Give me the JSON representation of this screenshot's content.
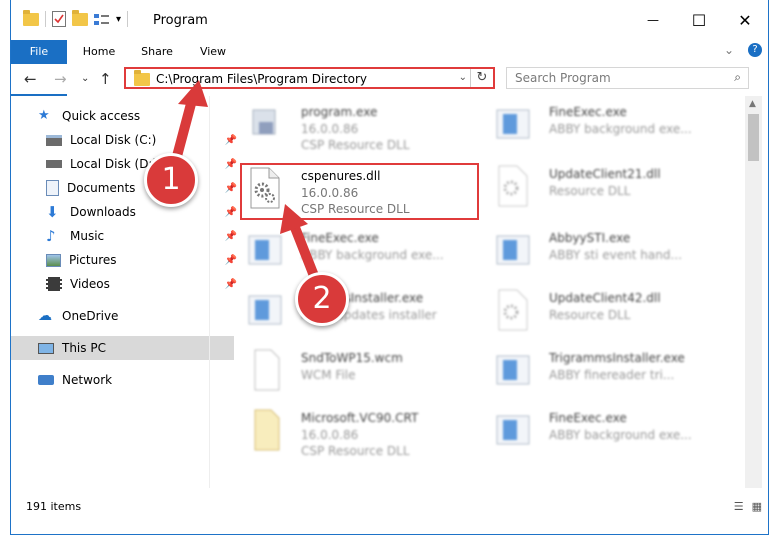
{
  "window": {
    "title": "Program",
    "minimize": "—",
    "maximize": "☐",
    "close": "✕"
  },
  "ribbon": {
    "tabs": [
      {
        "label": "File"
      },
      {
        "label": "Home"
      },
      {
        "label": "Share"
      },
      {
        "label": "View"
      }
    ],
    "expand": "⌄",
    "help": "?"
  },
  "nav": {
    "back": "←",
    "forward": "→",
    "recent": "⌄",
    "up": "↑"
  },
  "address": {
    "path": "C:\\Program Files\\Program Directory",
    "dropdown": "⌄",
    "refresh": "↻"
  },
  "search": {
    "placeholder": "Search Program",
    "icon": "⌕"
  },
  "sidebar": {
    "items": [
      {
        "label": "Quick access"
      },
      {
        "label": "Local Disk (C:)"
      },
      {
        "label": "Local Disk (D:)"
      },
      {
        "label": "Documents"
      },
      {
        "label": "Downloads"
      },
      {
        "label": "Music"
      },
      {
        "label": "Pictures"
      },
      {
        "label": "Videos"
      },
      {
        "label": "OneDrive"
      },
      {
        "label": "This PC"
      },
      {
        "label": "Network"
      }
    ]
  },
  "files": {
    "left": [
      {
        "name": "program.exe",
        "line1": "16.0.0.86",
        "line2": "CSP Resource DLL"
      },
      {
        "name": "cspenures.dll",
        "line1": "16.0.0.86",
        "line2": "CSP Resource DLL"
      },
      {
        "name": "FineExec.exe",
        "line1": "ABBY background exe...",
        "line2": ""
      },
      {
        "name": "UpdatesInstaller.exe",
        "line1": "ABBY updates installer",
        "line2": ""
      },
      {
        "name": "SndToWP15.wcm",
        "line1": "WCM File",
        "line2": ""
      },
      {
        "name": "Microsoft.VC90.CRT",
        "line1": "16.0.0.86",
        "line2": "CSP Resource DLL"
      }
    ],
    "right": [
      {
        "name": "FineExec.exe",
        "line1": "ABBY background exe...",
        "line2": ""
      },
      {
        "name": "UpdateClient21.dll",
        "line1": "Resource DLL",
        "line2": ""
      },
      {
        "name": "AbbyySTI.exe",
        "line1": "ABBY sti event hand...",
        "line2": ""
      },
      {
        "name": "UpdateClient42.dll",
        "line1": "Resource DLL",
        "line2": ""
      },
      {
        "name": "TrigrammsInstaller.exe",
        "line1": "ABBY finereader tri...",
        "line2": ""
      },
      {
        "name": "FineExec.exe",
        "line1": "ABBY background exe...",
        "line2": ""
      }
    ]
  },
  "status": {
    "count": "191 items"
  },
  "annotations": {
    "one": "1",
    "two": "2"
  },
  "colors": {
    "accent": "#1a6fc4",
    "highlight": "#e03b3b",
    "badge": "#d93a3a",
    "folder": "#f2c648"
  }
}
